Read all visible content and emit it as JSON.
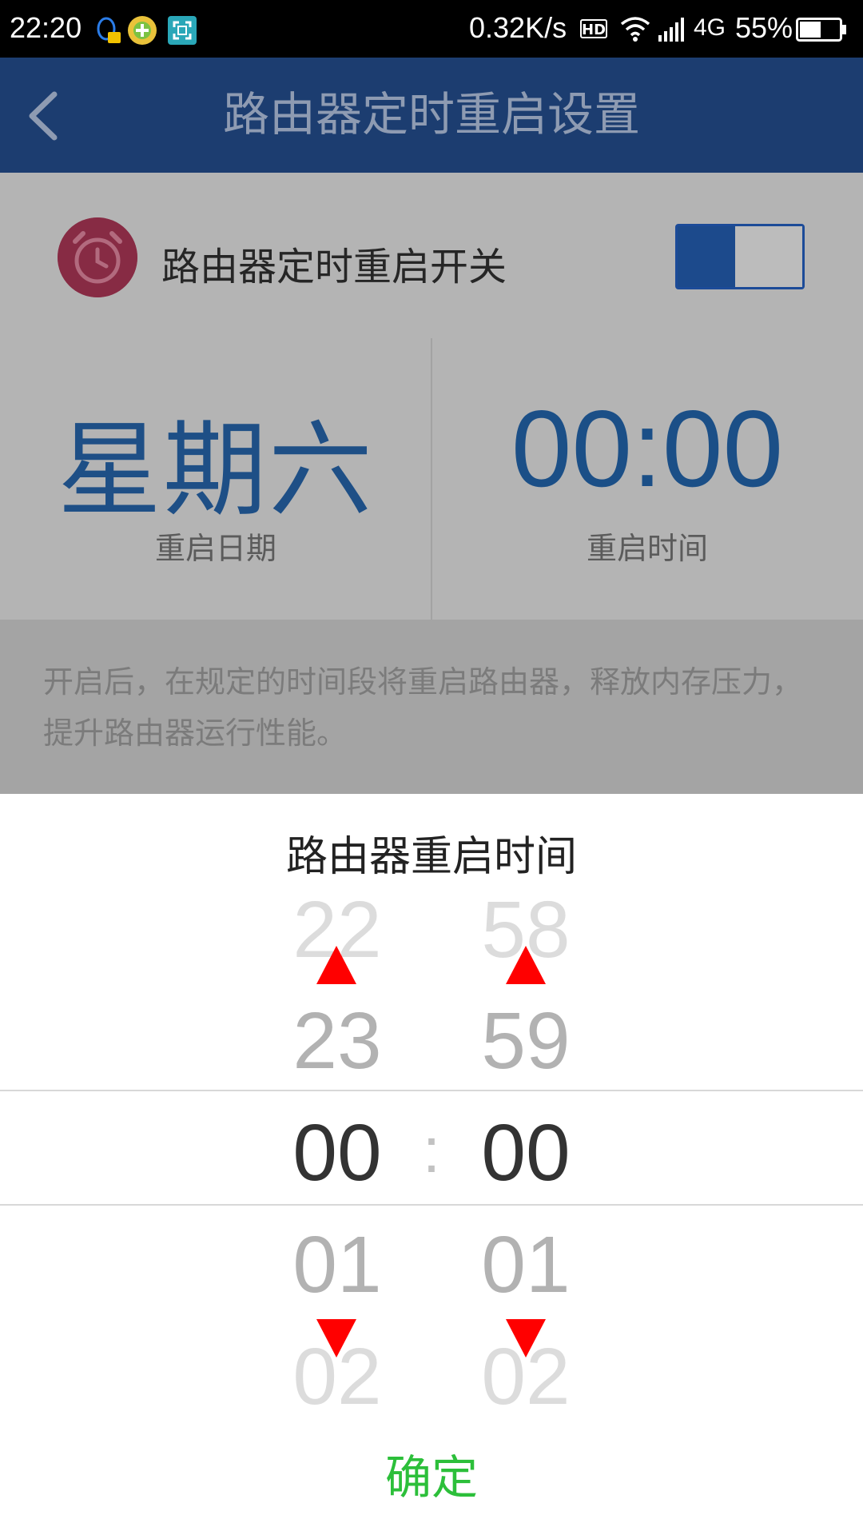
{
  "status_bar": {
    "time": "22:20",
    "net_speed": "0.32K/s",
    "hd_label": "HD",
    "network_type": "4G",
    "battery_percent": "55%",
    "battery_level": 0.55
  },
  "header": {
    "title": "路由器定时重启设置",
    "back_icon": "chevron-left-icon"
  },
  "switch_row": {
    "label": "路由器定时重启开关",
    "icon": "alarm-clock-icon",
    "toggle_on": true
  },
  "schedule": {
    "day_value": "星期六",
    "day_caption": "重启日期",
    "time_value": "00:00",
    "time_caption": "重启时间"
  },
  "description": "开启后，在规定的时间段将重启路由器，释放内存压力，提升路由器运行性能。",
  "picker": {
    "title": "路由器重启时间",
    "hours": [
      "22",
      "23",
      "00",
      "01",
      "02"
    ],
    "minutes": [
      "58",
      "59",
      "00",
      "01",
      "02"
    ],
    "separator": ":",
    "confirm_label": "确定"
  },
  "colors": {
    "header_bg": "#1c3d70",
    "accent_blue": "#1e4f86",
    "confirm_green": "#2cbf3a",
    "arrow_red": "#ff0000"
  }
}
